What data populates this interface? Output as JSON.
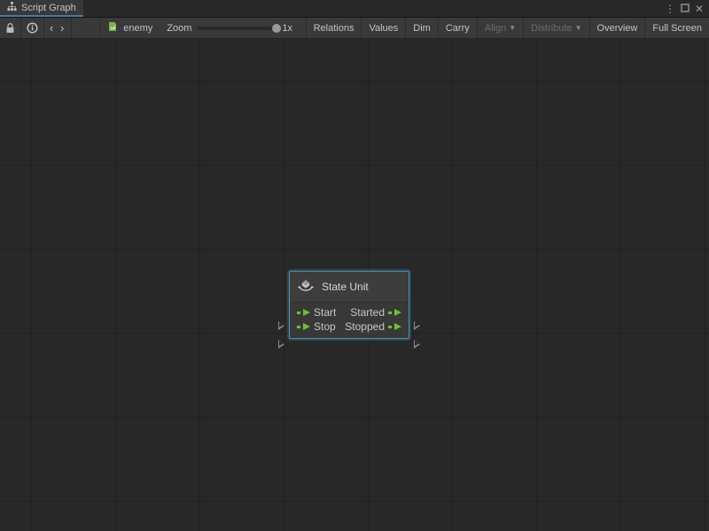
{
  "tab": {
    "title": "Script Graph"
  },
  "window_controls": {
    "more": "⋮",
    "maximize": "◻",
    "close": "✕"
  },
  "toolbar": {
    "lock_icon": "lock-icon",
    "info_icon": "info-icon",
    "breadcrumb_icon": "‹ ›",
    "graph_ref": "enemy",
    "zoom_label": "Zoom",
    "zoom_value": "1x",
    "btn_relations": "Relations",
    "btn_values": "Values",
    "btn_dim": "Dim",
    "btn_carry": "Carry",
    "btn_align": "Align",
    "btn_distribute": "Distribute",
    "btn_overview": "Overview",
    "btn_fullscreen": "Full Screen"
  },
  "node": {
    "title": "State Unit",
    "ports": {
      "in1": "Start",
      "out1": "Started",
      "in2": "Stop",
      "out2": "Stopped"
    }
  }
}
